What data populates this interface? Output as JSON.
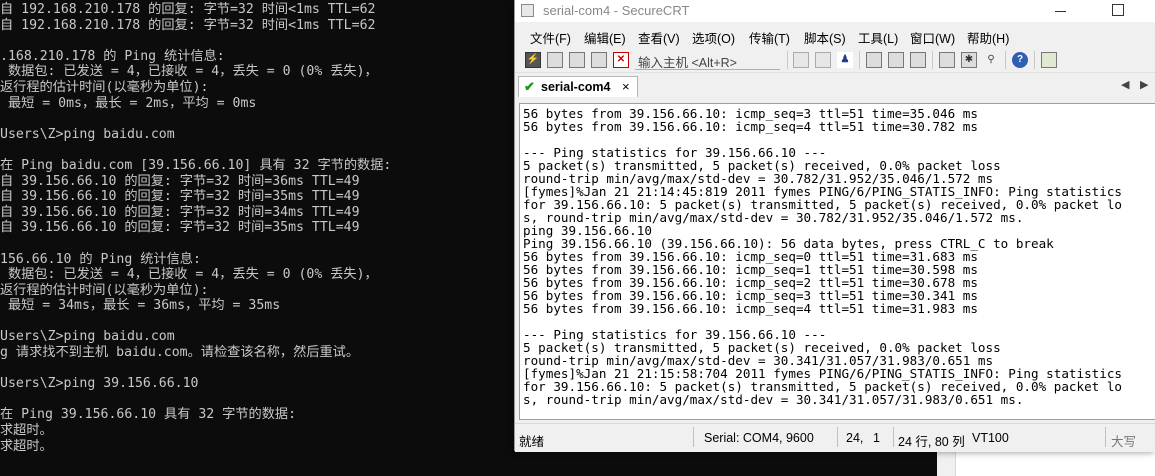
{
  "cmd": {
    "lines": [
      "自 192.168.210.178 的回复: 字节=32 时间<1ms TTL=62",
      "自 192.168.210.178 的回复: 字节=32 时间<1ms TTL=62",
      "",
      ".168.210.178 的 Ping 统计信息:",
      " 数据包: 已发送 = 4，已接收 = 4，丢失 = 0 (0% 丢失)，",
      "返行程的估计时间(以毫秒为单位):",
      " 最短 = 0ms，最长 = 2ms，平均 = 0ms",
      "",
      "Users\\Z>ping baidu.com",
      "",
      "在 Ping baidu.com [39.156.66.10] 具有 32 字节的数据:",
      "自 39.156.66.10 的回复: 字节=32 时间=36ms TTL=49",
      "自 39.156.66.10 的回复: 字节=32 时间=35ms TTL=49",
      "自 39.156.66.10 的回复: 字节=32 时间=34ms TTL=49",
      "自 39.156.66.10 的回复: 字节=32 时间=35ms TTL=49",
      "",
      "156.66.10 的 Ping 统计信息:",
      " 数据包: 已发送 = 4，已接收 = 4，丢失 = 0 (0% 丢失)，",
      "返行程的估计时间(以毫秒为单位):",
      " 最短 = 34ms，最长 = 36ms，平均 = 35ms",
      "",
      "Users\\Z>ping baidu.com",
      "g 请求找不到主机 baidu.com。请检查该名称，然后重试。",
      "",
      "Users\\Z>ping 39.156.66.10",
      "",
      "在 Ping 39.156.66.10 具有 32 字节的数据:",
      "求超时。",
      "求超时。"
    ]
  },
  "window": {
    "title": "serial-com4 - SecureCRT"
  },
  "menu": [
    "文件(F)",
    "编辑(E)",
    "查看(V)",
    "选项(O)",
    "传输(T)",
    "脚本(S)",
    "工具(L)",
    "窗口(W)",
    "帮助(H)"
  ],
  "toolbar": {
    "host_placeholder": "输入主机 <Alt+R>"
  },
  "tab": {
    "label": "serial-com4",
    "close": "×",
    "prev": "◀",
    "next": "▶"
  },
  "terminal": {
    "lines": [
      "56 bytes from 39.156.66.10: icmp_seq=3 ttl=51 time=35.046 ms",
      "56 bytes from 39.156.66.10: icmp_seq=4 ttl=51 time=30.782 ms",
      "",
      "--- Ping statistics for 39.156.66.10 ---",
      "5 packet(s) transmitted, 5 packet(s) received, 0.0% packet loss",
      "round-trip min/avg/max/std-dev = 30.782/31.952/35.046/1.572 ms",
      "[fymes]%Jan 21 21:14:45:819 2011 fymes PING/6/PING_STATIS_INFO: Ping statistics",
      "for 39.156.66.10: 5 packet(s) transmitted, 5 packet(s) received, 0.0% packet lo",
      "s, round-trip min/avg/max/std-dev = 30.782/31.952/35.046/1.572 ms.",
      "ping 39.156.66.10",
      "Ping 39.156.66.10 (39.156.66.10): 56 data bytes, press CTRL_C to break",
      "56 bytes from 39.156.66.10: icmp_seq=0 ttl=51 time=31.683 ms",
      "56 bytes from 39.156.66.10: icmp_seq=1 ttl=51 time=30.598 ms",
      "56 bytes from 39.156.66.10: icmp_seq=2 ttl=51 time=30.678 ms",
      "56 bytes from 39.156.66.10: icmp_seq=3 ttl=51 time=30.341 ms",
      "56 bytes from 39.156.66.10: icmp_seq=4 ttl=51 time=31.983 ms",
      "",
      "--- Ping statistics for 39.156.66.10 ---",
      "5 packet(s) transmitted, 5 packet(s) received, 0.0% packet loss",
      "round-trip min/avg/max/std-dev = 30.341/31.057/31.983/0.651 ms",
      "[fymes]%Jan 21 21:15:58:704 2011 fymes PING/6/PING_STATIS_INFO: Ping statistics",
      "for 39.156.66.10: 5 packet(s) transmitted, 5 packet(s) received, 0.0% packet lo",
      "s, round-trip min/avg/max/std-dev = 30.341/31.057/31.983/0.651 ms."
    ]
  },
  "status": {
    "ready": "就绪",
    "serial": "Serial: COM4, 9600",
    "row": "24,",
    "col": "1",
    "size": "24 行, 80 列",
    "emulation": "VT100",
    "caps": "大写"
  },
  "colors": {
    "console_bg": "#0c0c0c",
    "console_fg": "#c8c8c8",
    "terminal_bg": "#ffffff",
    "tab_check": "#1a9a1a"
  }
}
